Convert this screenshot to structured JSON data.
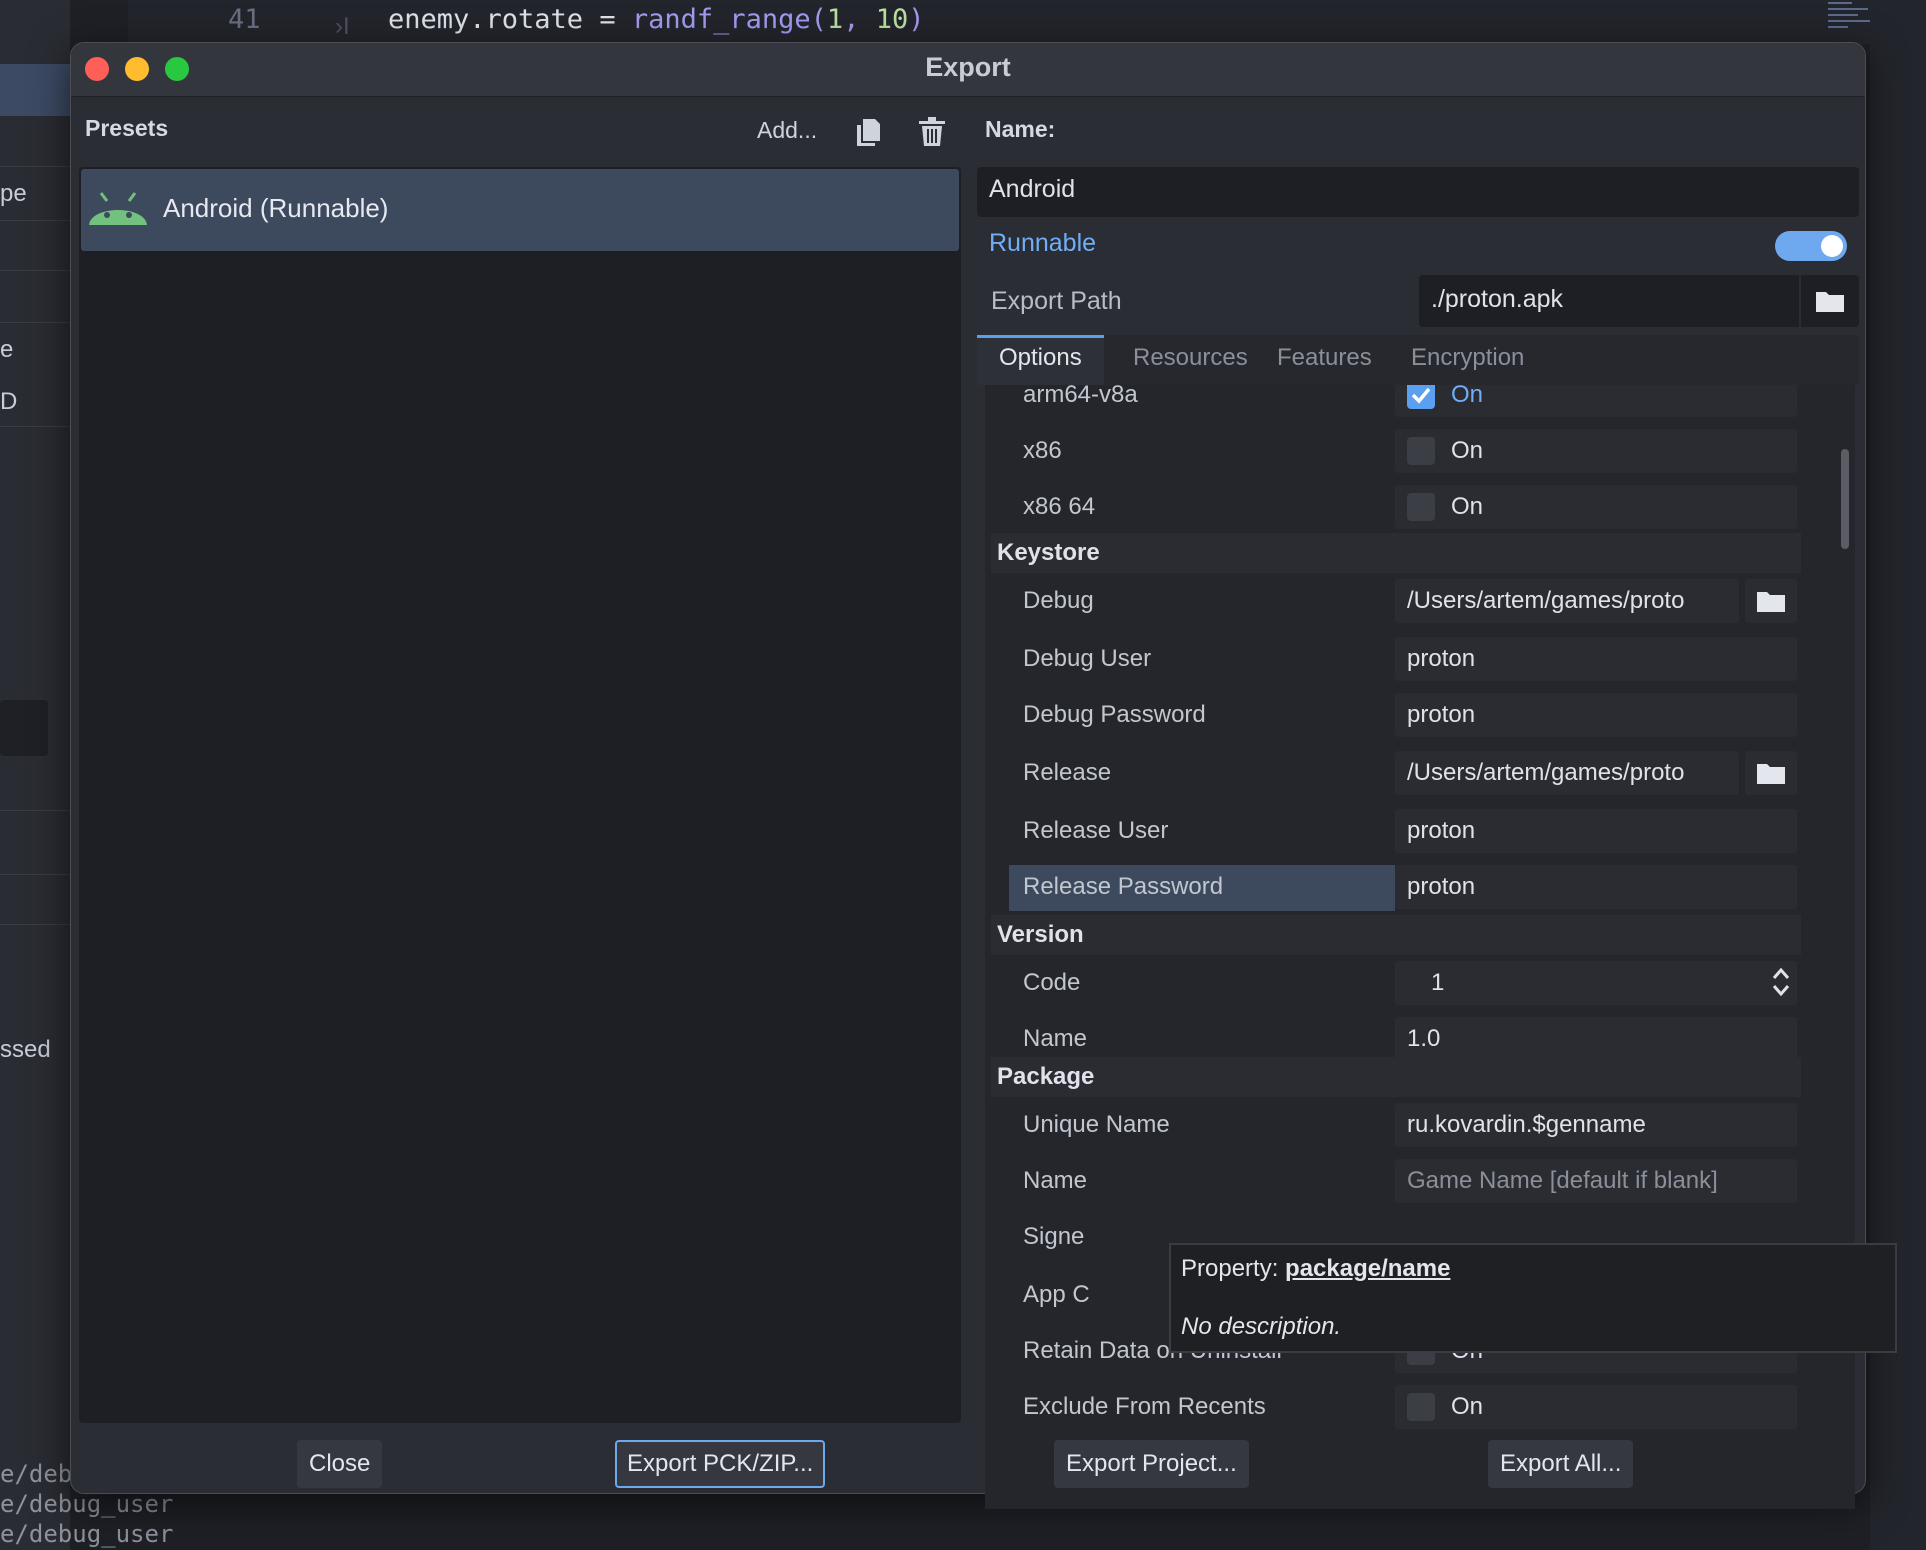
{
  "background": {
    "code_line_number": "41",
    "code_tab_marker": "›I",
    "code_text": {
      "lhs": "enemy.rotate = ",
      "fn": "randf_range",
      "args_open": "(",
      "arg1": "1",
      "sep": ", ",
      "arg2": "10",
      "args_close": ")"
    },
    "left_fragments": [
      "pe",
      "e",
      "D",
      "ssed"
    ],
    "bottom_lines": [
      "e/deb",
      "e/debug_user",
      "e/debug_user"
    ]
  },
  "dialog": {
    "title": "Export",
    "presets_label": "Presets",
    "add_label": "Add...",
    "presets": [
      {
        "label": "Android (Runnable)",
        "icon": "android-icon",
        "selected": true
      }
    ],
    "name_label": "Name:",
    "name_value": "Android",
    "runnable_label": "Runnable",
    "runnable_on": true,
    "export_path_label": "Export Path",
    "export_path_value": "./proton.apk",
    "tabs": [
      "Options",
      "Resources",
      "Features",
      "Encryption"
    ],
    "active_tab": "Options",
    "architectures": [
      {
        "label": "arm64-v8a",
        "checked": true,
        "text": "On"
      },
      {
        "label": "x86",
        "checked": false,
        "text": "On"
      },
      {
        "label": "x86 64",
        "checked": false,
        "text": "On"
      }
    ],
    "keystore": {
      "title": "Keystore",
      "debug_label": "Debug",
      "debug_value": "/Users/artem/games/proto",
      "debug_user_label": "Debug User",
      "debug_user_value": "proton",
      "debug_password_label": "Debug Password",
      "debug_password_value": "proton",
      "release_label": "Release",
      "release_value": "/Users/artem/games/proto",
      "release_user_label": "Release User",
      "release_user_value": "proton",
      "release_password_label": "Release Password",
      "release_password_value": "proton"
    },
    "version": {
      "title": "Version",
      "code_label": "Code",
      "code_value": "1",
      "name_label": "Name",
      "name_value": "1.0"
    },
    "package": {
      "title": "Package",
      "unique_name_label": "Unique Name",
      "unique_name_value": "ru.kovardin.$genname",
      "name_label": "Name",
      "name_placeholder": "Game Name [default if blank]",
      "signed_label": "Signe",
      "app_category_label": "App C",
      "retain_label": "Retain Data on Uninstall",
      "retain_text": "On",
      "exclude_label": "Exclude From Recents",
      "exclude_text": "On"
    },
    "tooltip": {
      "prefix": "Property: ",
      "property": "package/name",
      "description": "No description."
    },
    "buttons": {
      "close": "Close",
      "export_pck": "Export PCK/ZIP...",
      "export_project": "Export Project...",
      "export_all": "Export All..."
    },
    "colors": {
      "accent": "#70aef5",
      "selection": "#3d4a5e",
      "close_light": "#ff5f57",
      "min_light": "#febc2e",
      "max_light": "#28c840"
    }
  }
}
